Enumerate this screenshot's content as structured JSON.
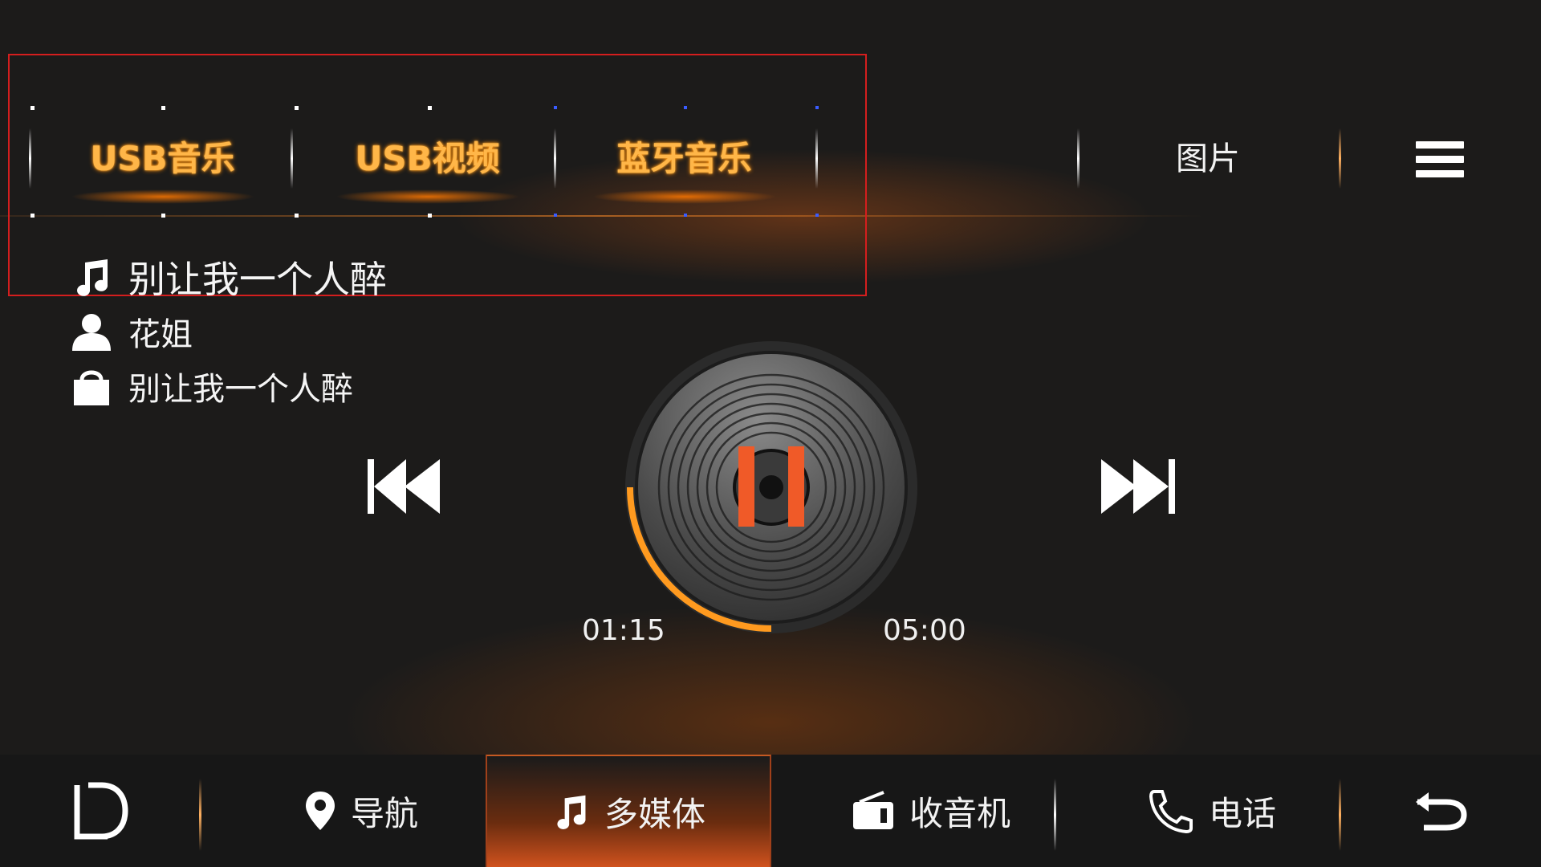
{
  "tabs": {
    "usb_music": "USB音乐",
    "usb_video": "USB视频",
    "bt_music": "蓝牙音乐",
    "pictures": "图片"
  },
  "song": {
    "title": "别让我一个人醉",
    "artist": "花姐",
    "album": "别让我一个人醉"
  },
  "player": {
    "elapsed": "01:15",
    "duration": "05:00",
    "progress": 0.25,
    "state": "playing"
  },
  "nav": {
    "navigation": "导航",
    "media": "多媒体",
    "radio": "收音机",
    "phone": "电话"
  },
  "colors": {
    "accent": "#ff9a1f",
    "tab_text": "#ffb648",
    "active_nav": "#d0521e",
    "pause": "#f05a28"
  }
}
